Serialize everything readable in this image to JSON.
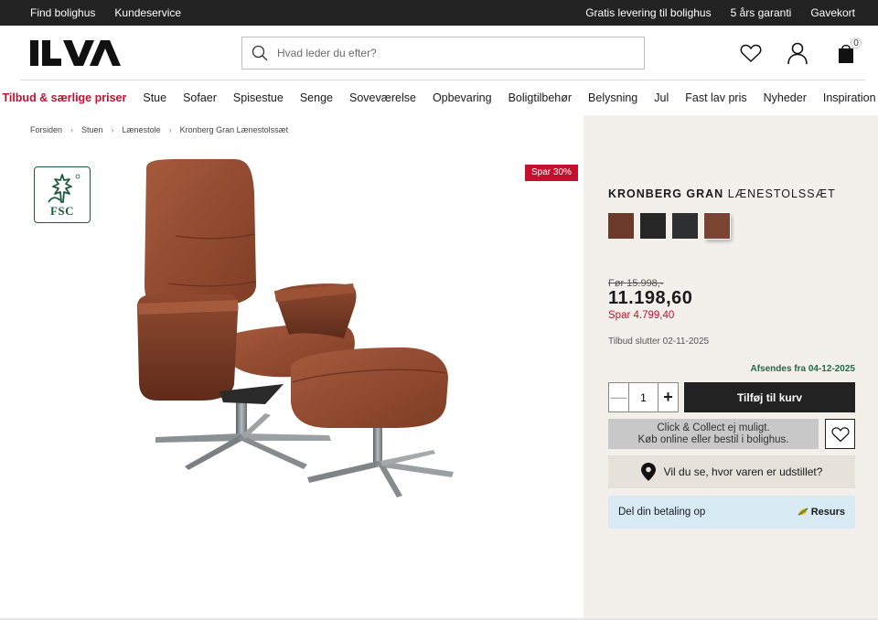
{
  "topbar": {
    "left": [
      "Find bolighus",
      "Kundeservice"
    ],
    "right": [
      "Gratis levering til bolighus",
      "5 års garanti",
      "Gavekort"
    ]
  },
  "header": {
    "logo": "ILVA",
    "search_placeholder": "Hvad leder du efter?",
    "cart_count": "0"
  },
  "nav": {
    "items": [
      "Tilbud & særlige priser",
      "Stue",
      "Sofaer",
      "Spisestue",
      "Senge",
      "Soveværelse",
      "Opbevaring",
      "Boligtilbehør",
      "Belysning",
      "Jul",
      "Fast lav pris",
      "Nyheder",
      "Inspiration"
    ]
  },
  "breadcrumb": [
    "Forsiden",
    "Stuen",
    "Lænestole",
    "Kronberg Gran Lænestolssæt"
  ],
  "fsc": {
    "label": "FSC"
  },
  "badge": "Spar 30%",
  "product": {
    "brand": "KRONBERG GRAN",
    "name": "LÆNESTOLSSÆT",
    "swatches": [
      "#6b3a2a",
      "#262626",
      "#2d2f31",
      "#7a4432"
    ],
    "old_price": "Før 15.998,-",
    "price": "11.198,60",
    "save": "Spar 4.799,40",
    "offer_end": "Tilbud slutter 02-11-2025",
    "shipping": "Afsendes fra 04-12-2025",
    "qty": "1",
    "add_to_cart": "Tilføj til kurv",
    "collect_line1": "Click & Collect ej muligt.",
    "collect_line2": "Køb online eller bestil i bolighus.",
    "showroom": "Vil du se, hvor varen er udstillet?",
    "split_payment": "Del din betaling op",
    "resurs_logo": "Resurs"
  }
}
